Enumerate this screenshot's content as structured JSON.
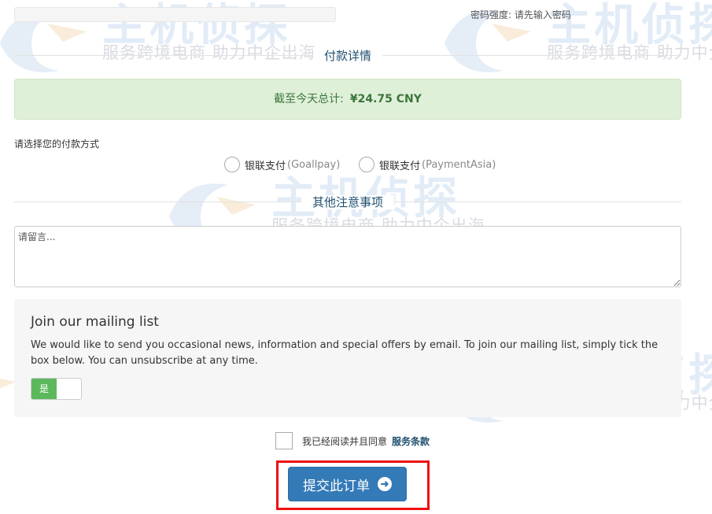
{
  "password": {
    "strength_label": "密码强度: 请先输入密码"
  },
  "payment_details": {
    "title": "付款详情",
    "total_label": "截至今天总计:",
    "total_value": "¥24.75 CNY"
  },
  "payment_method": {
    "label": "请选择您的付款方式",
    "options": [
      {
        "name": "银联支付",
        "sub": "(Goallpay)"
      },
      {
        "name": "银联支付",
        "sub": "(PaymentAsia)"
      }
    ]
  },
  "notes": {
    "title": "其他注意事项",
    "placeholder": "请留言..."
  },
  "mailing": {
    "title": "Join our mailing list",
    "text": "We would like to send you occasional news, information and special offers by email. To join our mailing list, simply tick the box below. You can unsubscribe at any time.",
    "toggle_on_label": "是"
  },
  "terms": {
    "text": "我已经阅读并且同意",
    "link": "服务条款"
  },
  "submit": {
    "label": "提交此订单",
    "icon": "arrow-circle-right-icon"
  },
  "watermark": {
    "brand": "主机侦探",
    "tagline": "服务跨境电商 助力中企出海"
  },
  "colors": {
    "primary": "#337ab7",
    "success_bg": "#dff0d8",
    "success_text": "#3c763d",
    "toggle_on": "#5cb85c",
    "highlight": "#ee1111",
    "heading": "#1d4e6e"
  }
}
